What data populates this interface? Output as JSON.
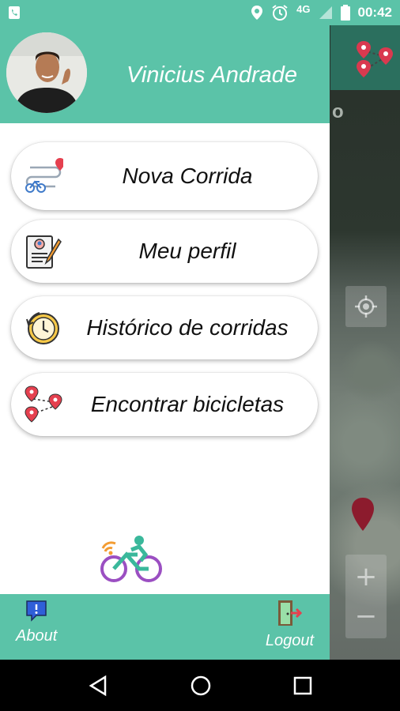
{
  "status_bar": {
    "time": "00:42",
    "network": "4G"
  },
  "drawer": {
    "user_name": "Vinicius Andrade",
    "menu": [
      {
        "label": "Nova Corrida",
        "icon": "route-bike-icon"
      },
      {
        "label": "Meu perfil",
        "icon": "profile-document-icon"
      },
      {
        "label": "Histórico de corridas",
        "icon": "clock-history-icon"
      },
      {
        "label": "Encontrar bicicletas",
        "icon": "map-pins-icon"
      }
    ],
    "footer": {
      "about_label": "About",
      "logout_label": "Logout"
    }
  },
  "map": {
    "title_fragment": "o",
    "zoom_in": "+",
    "zoom_out": "−"
  },
  "colors": {
    "accent": "#5bc3a8",
    "marker": "#8c1b2d",
    "bike_purple": "#9b4fc2",
    "bike_orange": "#f39c32"
  }
}
